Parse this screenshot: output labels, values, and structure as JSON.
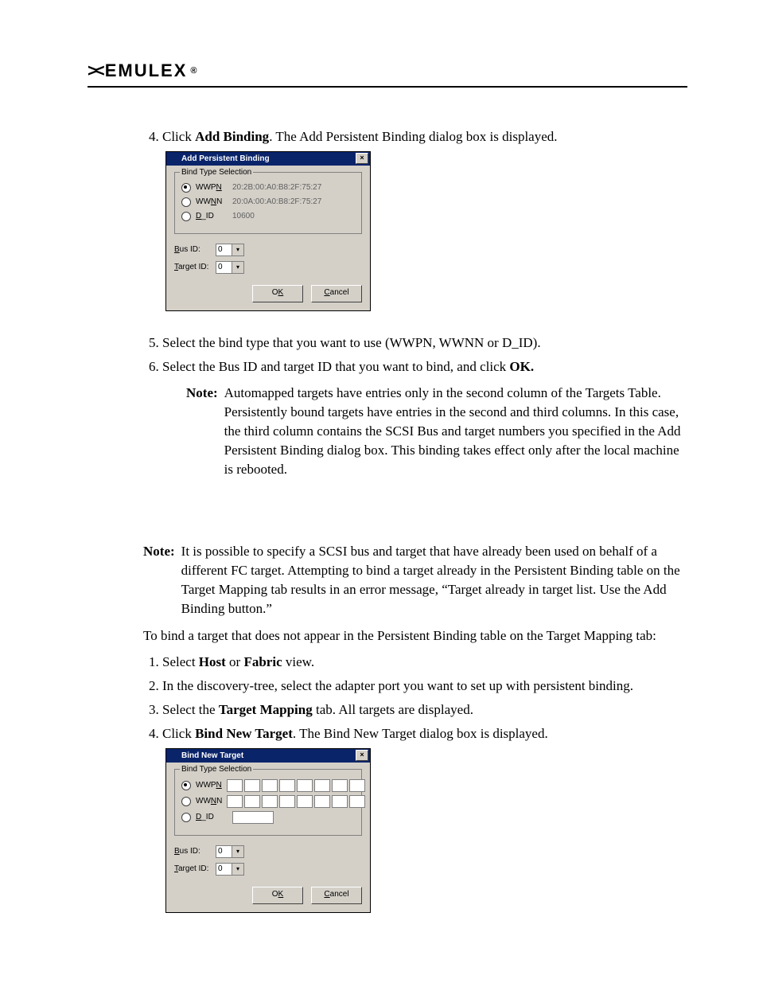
{
  "logo": {
    "text": "EMULEX"
  },
  "steps1": {
    "4": {
      "pre": "Click ",
      "bold": "Add Binding",
      "post": ". The Add Persistent Binding dialog box is displayed."
    },
    "5": "Select the bind type that you want to use (WWPN, WWNN or D_ID).",
    "6": {
      "pre": "Select the Bus ID and target ID that you want to bind, and click ",
      "bold": "OK."
    }
  },
  "dialog1": {
    "title": "Add Persistent Binding",
    "group_title": "Bind Type Selection",
    "opts": {
      "wwpn": {
        "label_pre": "WWP",
        "label_ul": "N",
        "value": "20:2B:00:A0:B8:2F:75:27"
      },
      "wwnn": {
        "label_pre": "WW",
        "label_ul": "N",
        "label_post": "N",
        "value": "20:0A:00:A0:B8:2F:75:27"
      },
      "did": {
        "label_ul": "D",
        "label_post": "_ID",
        "value": "10600"
      }
    },
    "bus_label_ul": "B",
    "bus_label_post": "us ID:",
    "bus_val": "0",
    "target_label_ul": "T",
    "target_label_post": "arget ID:",
    "target_val": "0",
    "ok_pre": "O",
    "ok_ul": "K",
    "cancel_ul": "C",
    "cancel_post": "ancel"
  },
  "note1": {
    "label": "Note:",
    "text": "Automapped targets have entries only in the second column of the Targets Table. Persistently bound targets have entries in the second and third columns. In this case, the third column contains the SCSI Bus and target numbers you specified in the Add Persistent Binding dialog box. This binding takes effect only after the local machine is rebooted."
  },
  "note2": {
    "label": "Note:",
    "text": "It is possible to specify a SCSI bus and target that have already been used on behalf of a different FC target. Attempting to bind a target already in the Persistent Binding table on the Target Mapping tab results in an error message, “Target already in target list. Use the Add Binding button.”"
  },
  "para_bind": "To bind a target that does not appear in the Persistent Binding table on the Target Mapping tab:",
  "steps2": {
    "1": {
      "pre": "Select ",
      "b1": "Host",
      "mid": " or ",
      "b2": "Fabric",
      "post": " view."
    },
    "2": "In the discovery-tree, select the adapter port you want to set up with persistent binding.",
    "3": {
      "pre": "Select the ",
      "bold": "Target Mapping",
      "post": " tab. All targets are displayed."
    },
    "4": {
      "pre": "Click ",
      "bold": "Bind New Target",
      "post": ". The Bind New Target dialog box is displayed."
    }
  },
  "dialog2": {
    "title": "Bind New Target",
    "group_title": "Bind Type Selection",
    "opts": {
      "wwpn": {
        "label_pre": "WWP",
        "label_ul": "N"
      },
      "wwnn": {
        "label_pre": "WW",
        "label_ul": "N",
        "label_post": "N"
      },
      "did": {
        "label_ul": "D",
        "label_post": "_ID"
      }
    },
    "bus_label_ul": "B",
    "bus_label_post": "us ID:",
    "bus_val": "0",
    "target_label_ul": "T",
    "target_label_post": "arget ID:",
    "target_val": "0",
    "ok_pre": "O",
    "ok_ul": "K",
    "cancel_ul": "C",
    "cancel_post": "ancel"
  }
}
